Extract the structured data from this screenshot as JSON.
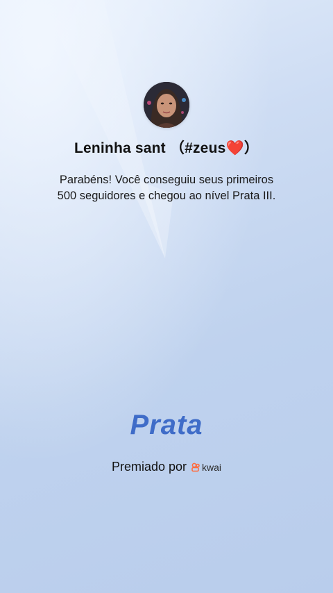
{
  "profile": {
    "name": "Leninha sant （#zeus❤️）",
    "avatar_icon": "profile-photo"
  },
  "message": {
    "line1": "Parabéns! Você conseguiu seus primeiros",
    "line2": "500 seguidores e chegou ao nível Prata III."
  },
  "level": {
    "title": "Prata",
    "color": "#3f6cc8"
  },
  "footer": {
    "awarded_by": "Premiado por",
    "brand": "kwai",
    "brand_icon": "kwai-logo-icon",
    "brand_color": "#ff6b3d"
  }
}
